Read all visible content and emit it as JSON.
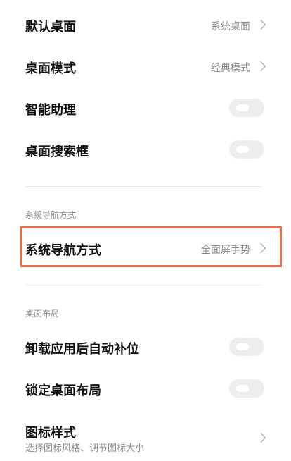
{
  "desktop_settings": {
    "default_desktop": {
      "label": "默认桌面",
      "value": "系统桌面"
    },
    "desktop_mode": {
      "label": "桌面模式",
      "value": "经典模式"
    },
    "smart_assistant": {
      "label": "智能助理"
    },
    "desktop_search": {
      "label": "桌面搜索框"
    }
  },
  "navigation_section": {
    "title": "系统导航方式",
    "nav_mode": {
      "label": "系统导航方式",
      "value": "全面屏手势"
    }
  },
  "layout_section": {
    "title": "桌面布局",
    "auto_fill": {
      "label": "卸载应用后自动补位"
    },
    "lock_layout": {
      "label": "锁定桌面布局"
    },
    "icon_style": {
      "label": "图标样式",
      "subtitle": "选择图标风格、调节图标大小"
    }
  },
  "toggles": {
    "smart_assistant_on": false,
    "desktop_search_on": false,
    "auto_fill_on": false,
    "lock_layout_on": false
  },
  "colors": {
    "highlight": "#e86f43",
    "toggle_off": "#ededed",
    "secondary_text": "#8a8a8a"
  }
}
